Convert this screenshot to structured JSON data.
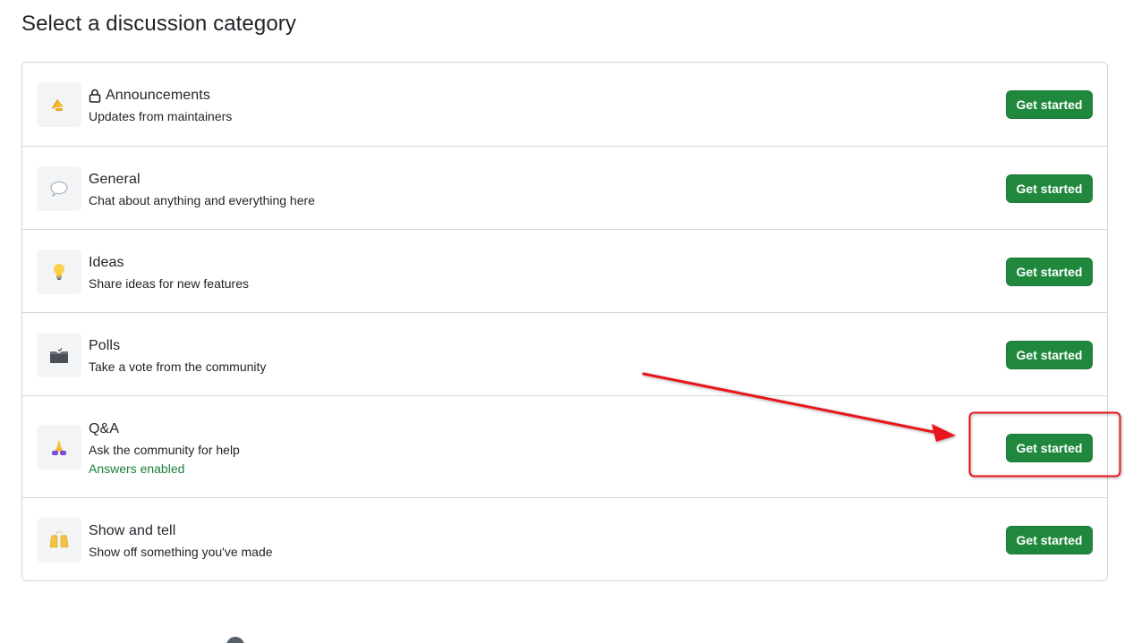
{
  "page": {
    "title": "Select a discussion category"
  },
  "categories": [
    {
      "icon": "megaphone-icon",
      "locked": true,
      "name": "Announcements",
      "description": "Updates from maintainers",
      "button_label": "Get started"
    },
    {
      "icon": "speech-balloon-icon",
      "locked": false,
      "name": "General",
      "description": "Chat about anything and everything here",
      "button_label": "Get started"
    },
    {
      "icon": "light-bulb-icon",
      "locked": false,
      "name": "Ideas",
      "description": "Share ideas for new features",
      "button_label": "Get started"
    },
    {
      "icon": "ballot-box-icon",
      "locked": false,
      "name": "Polls",
      "description": "Take a vote from the community",
      "button_label": "Get started"
    },
    {
      "icon": "praying-hands-icon",
      "locked": false,
      "name": "Q&A",
      "description": "Ask the community for help",
      "answers_label": "Answers enabled",
      "button_label": "Get started"
    },
    {
      "icon": "raising-hands-icon",
      "locked": false,
      "name": "Show and tell",
      "description": "Show off something you've made",
      "button_label": "Get started"
    }
  ],
  "colors": {
    "button_bg": "#1f883d",
    "answers_text": "#1a7f37",
    "annotation": "#e8141c",
    "border": "#d0d7de"
  }
}
